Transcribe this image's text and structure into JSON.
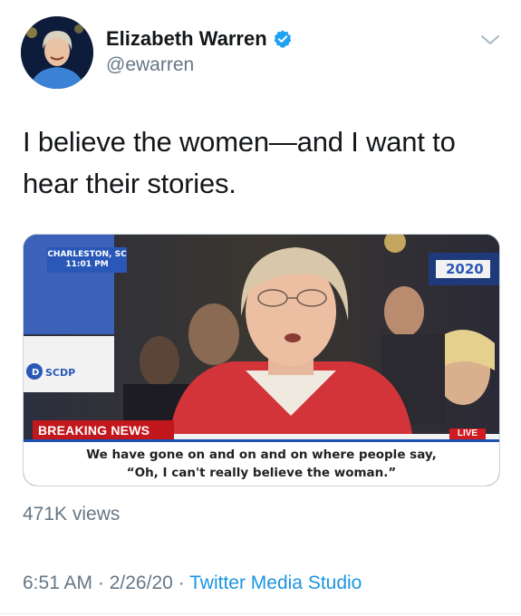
{
  "author": {
    "display_name": "Elizabeth Warren",
    "handle": "@ewarren",
    "verified_icon": "verified-badge-icon"
  },
  "tweet": {
    "text_line1": "I believe the women—and I want to",
    "text_line2": "hear their stories."
  },
  "media": {
    "location_line1": "CHARLESTON, SC",
    "location_line2": "11:01 PM",
    "sign_left": "SCDP",
    "sign_right": "2020",
    "breaking_label": "BREAKING NEWS",
    "live_label": "LIVE",
    "caption_line1": "We have gone on and on and on where people say,",
    "caption_line2": "“Oh, I can't really believe the woman.”"
  },
  "stats": {
    "views": "471K views"
  },
  "meta": {
    "time": "6:51 AM",
    "separator1": " · ",
    "date": "2/26/20",
    "separator2": " · ",
    "source": "Twitter Media Studio"
  },
  "colors": {
    "link": "#1b95e0",
    "muted": "#657786",
    "breaking_red": "#c2171d",
    "caption_blue": "#1f4fb0"
  }
}
